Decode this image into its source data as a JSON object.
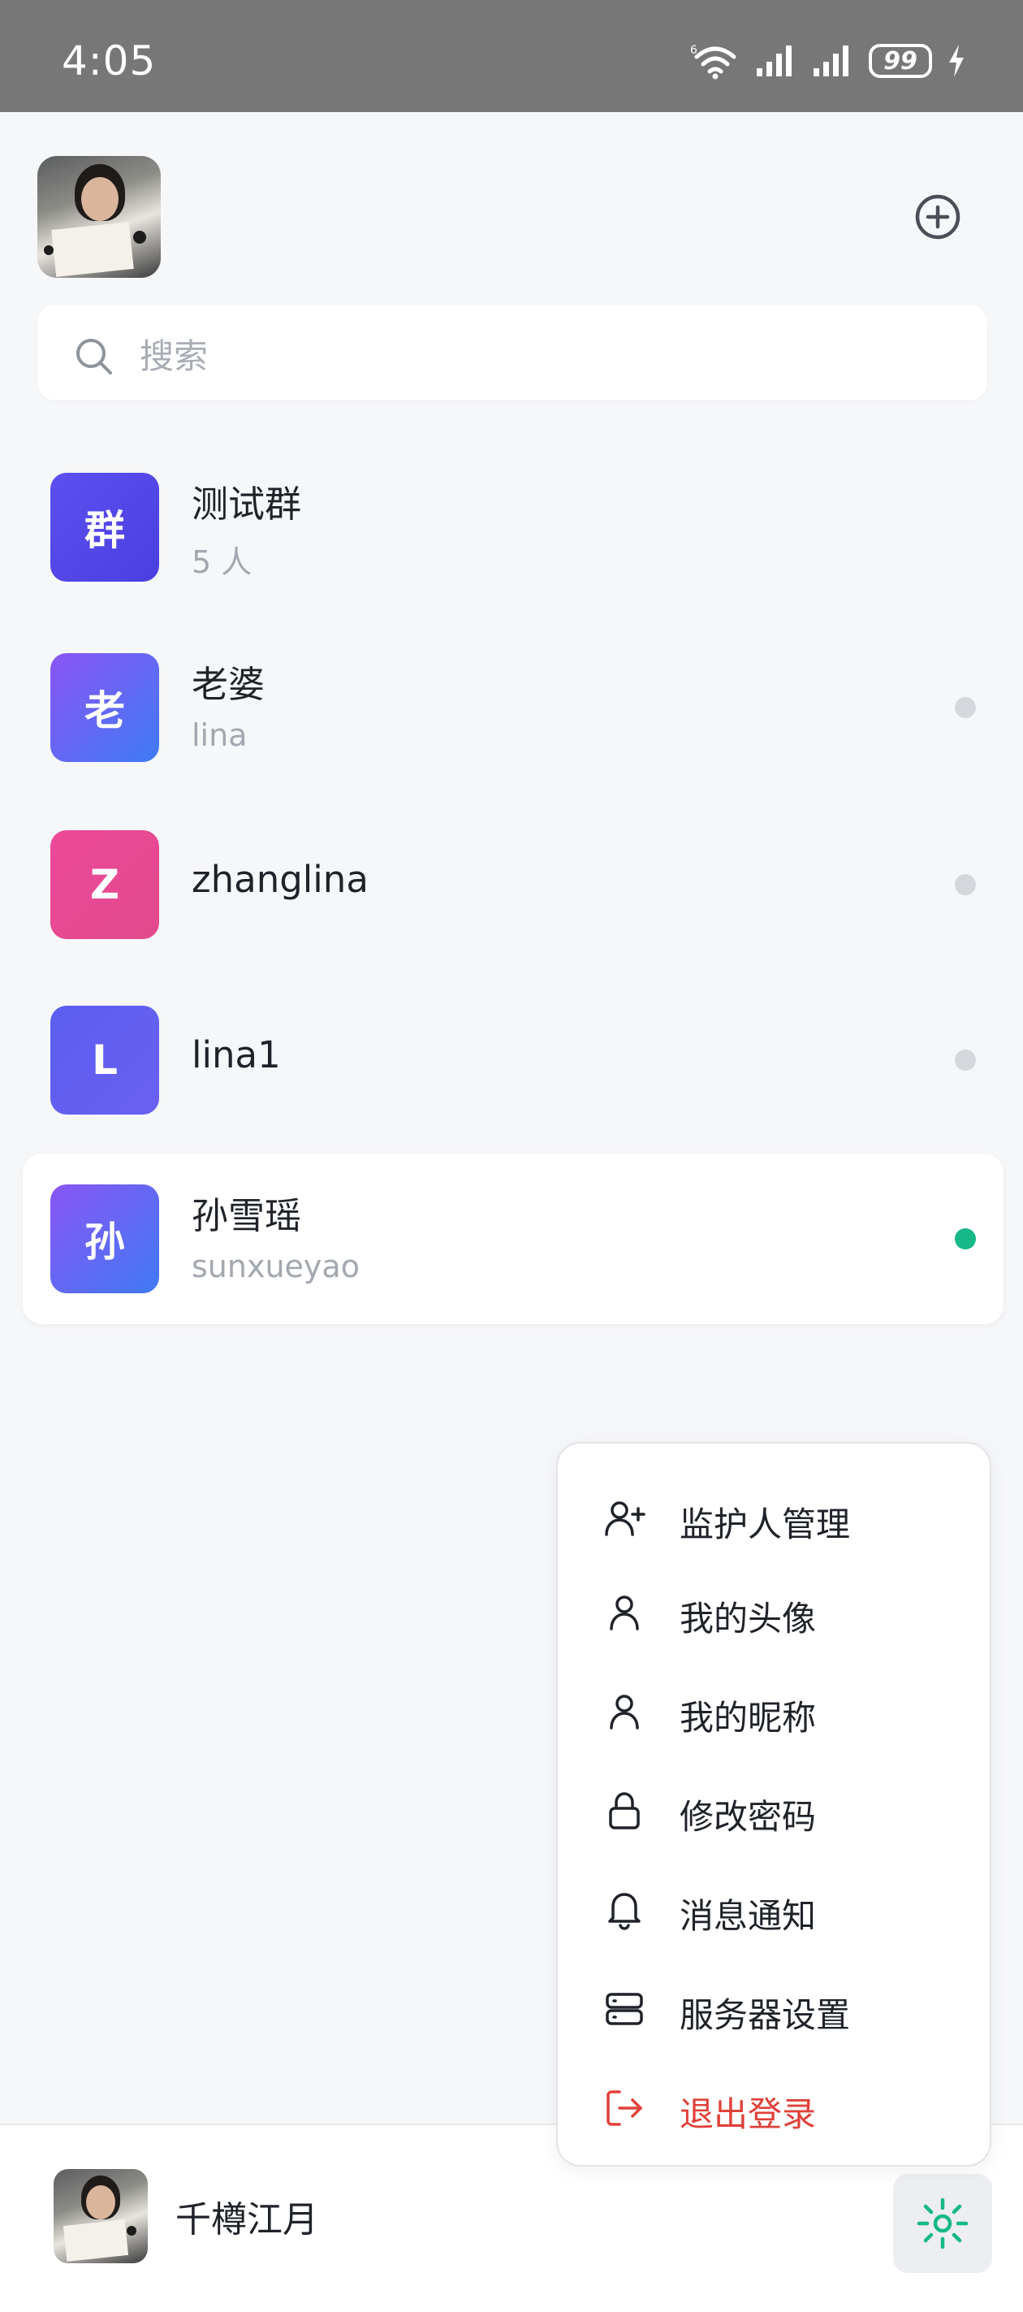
{
  "status_bar": {
    "time": "4:05",
    "battery": "99",
    "network": "6"
  },
  "header": {
    "add_label": "+"
  },
  "search": {
    "placeholder": "搜索"
  },
  "contacts": [
    {
      "initial": "群",
      "name": "测试群",
      "sub": "5 人",
      "color": "#5546e6",
      "status": "none"
    },
    {
      "initial": "老",
      "name": "老婆",
      "sub": "lina",
      "color": "#6a62f1",
      "status": "offline"
    },
    {
      "initial": "Z",
      "name": "zhanglina",
      "sub": "",
      "color": "#e64690",
      "status": "offline"
    },
    {
      "initial": "L",
      "name": "lina1",
      "sub": "",
      "color": "#5e5cf0",
      "status": "offline"
    },
    {
      "initial": "孙",
      "name": "孙雪瑶",
      "sub": "sunxueyao",
      "color": "#6a62f1",
      "status": "online"
    }
  ],
  "menu": {
    "items": [
      {
        "label": "监护人管理",
        "icon": "user-plus-icon"
      },
      {
        "label": "我的头像",
        "icon": "user-icon"
      },
      {
        "label": "我的昵称",
        "icon": "user-icon"
      },
      {
        "label": "修改密码",
        "icon": "lock-icon"
      },
      {
        "label": "消息通知",
        "icon": "bell-icon"
      },
      {
        "label": "服务器设置",
        "icon": "server-icon"
      },
      {
        "label": "退出登录",
        "icon": "logout-icon"
      }
    ]
  },
  "footer": {
    "username": "千樽江月"
  },
  "colors": {
    "accent": "#15b886",
    "danger": "#e0413a",
    "offline": "#d4d7dc"
  }
}
